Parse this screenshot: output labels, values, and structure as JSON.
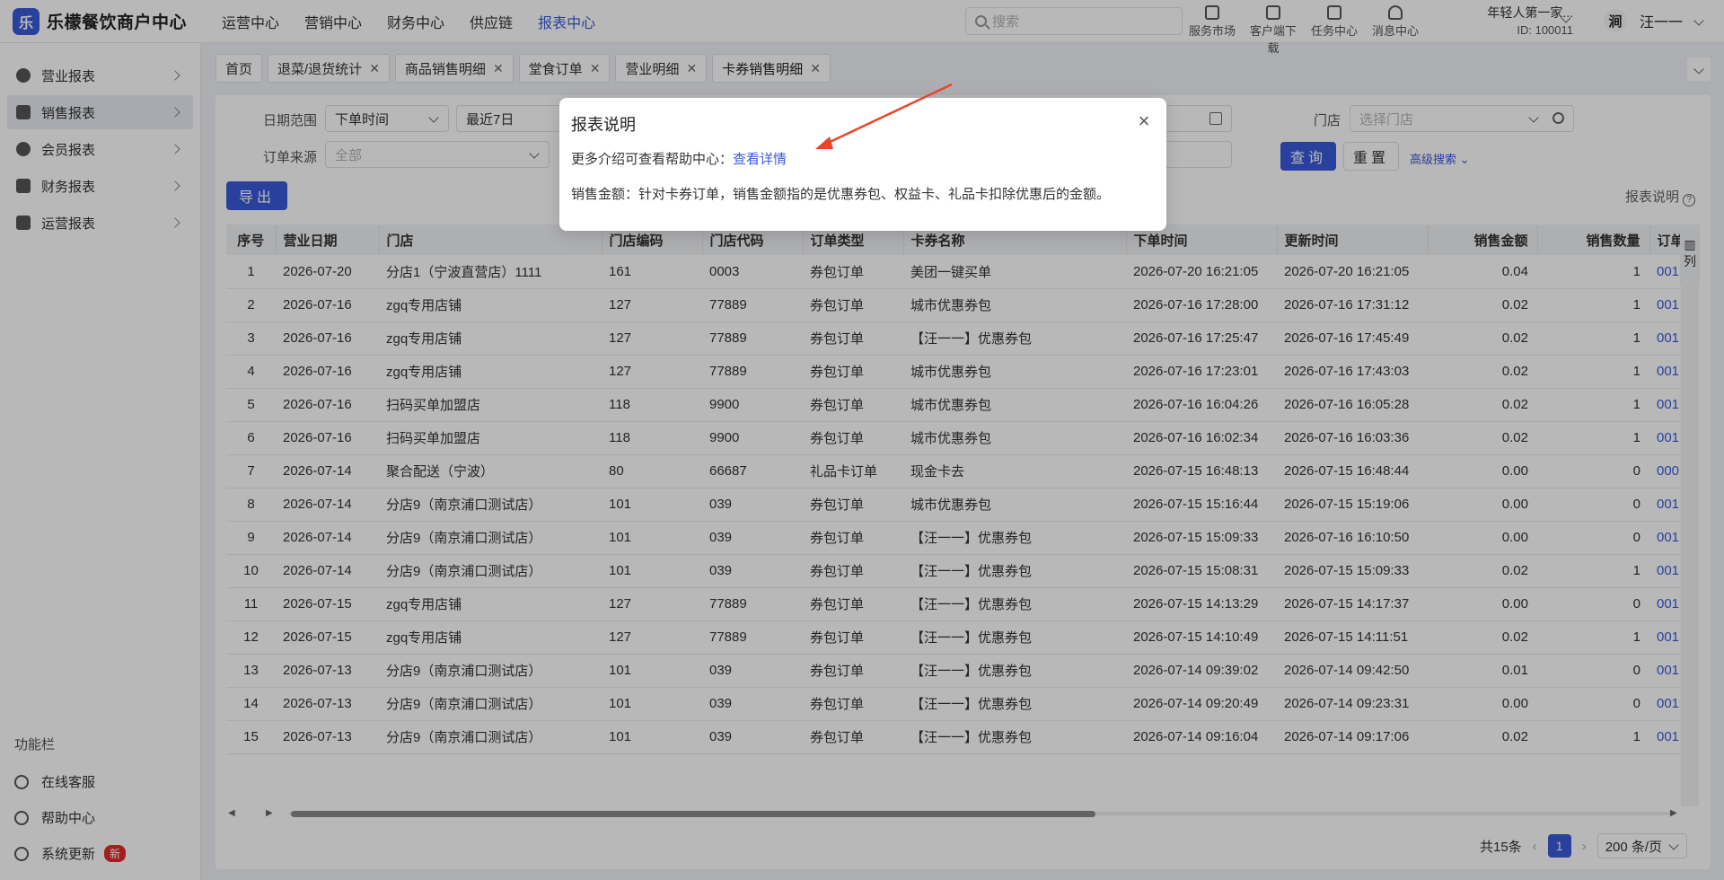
{
  "app": {
    "title": "乐檬餐饮商户中心",
    "logo_glyph": "乐"
  },
  "topnav": [
    {
      "label": "运营中心",
      "active": false
    },
    {
      "label": "营销中心",
      "active": false
    },
    {
      "label": "财务中心",
      "active": false
    },
    {
      "label": "供应链",
      "active": false
    },
    {
      "label": "报表中心",
      "active": true
    }
  ],
  "search": {
    "placeholder": "搜索"
  },
  "tools": [
    {
      "label": "服务市场",
      "icon": "market-icon"
    },
    {
      "label": "客户端下载",
      "icon": "download-icon"
    },
    {
      "label": "任务中心",
      "icon": "task-icon"
    },
    {
      "label": "消息中心",
      "icon": "bell-icon"
    }
  ],
  "tenant": {
    "name": "年轻人第一家...",
    "id": "ID: 100011"
  },
  "user": {
    "avatar_text": "涧",
    "name": "汪一一"
  },
  "sidebar": {
    "items": [
      {
        "label": "营业报表",
        "icon": "chart-pie-icon"
      },
      {
        "label": "销售报表",
        "icon": "bank-icon",
        "active": true
      },
      {
        "label": "会员报表",
        "icon": "user-icon"
      },
      {
        "label": "财务报表",
        "icon": "ledger-icon"
      },
      {
        "label": "运营报表",
        "icon": "briefcase-icon"
      }
    ],
    "func_title": "功能栏",
    "func_items": [
      {
        "label": "在线客服",
        "icon": "headset-icon"
      },
      {
        "label": "帮助中心",
        "icon": "help-icon"
      },
      {
        "label": "系统更新",
        "icon": "refresh-icon",
        "badge": "新"
      }
    ]
  },
  "tabs": [
    {
      "label": "首页",
      "closable": false
    },
    {
      "label": "退菜/退货统计",
      "closable": true
    },
    {
      "label": "商品销售明细",
      "closable": true
    },
    {
      "label": "堂食订单",
      "closable": true
    },
    {
      "label": "营业明细",
      "closable": true
    },
    {
      "label": "卡券销售明细",
      "closable": true,
      "active": true
    }
  ],
  "filters": {
    "date_range_label": "日期范围",
    "date_type": "下单时间",
    "date_preset": "最近7日",
    "store_label": "门店",
    "store_placeholder": "选择门店",
    "source_label": "订单来源",
    "source_value": "全部",
    "query_label": "查询",
    "reset_label": "重置",
    "advanced_label": "高级搜索"
  },
  "export_label": "导出",
  "report_note_label": "报表说明",
  "table": {
    "columns": [
      "序号",
      "营业日期",
      "门店",
      "门店编码",
      "门店代码",
      "订单类型",
      "卡券名称",
      "下单时间",
      "更新时间",
      "销售金额",
      "销售数量",
      "订单号"
    ],
    "rows": [
      [
        "1",
        "2026-07-20",
        "分店1（宁波直营店）1111",
        "161",
        "0003",
        "券包订单",
        "美团一键买单",
        "2026-07-20 16:21:05",
        "2026-07-20 16:21:05",
        "0.04",
        "1",
        "001"
      ],
      [
        "2",
        "2026-07-16",
        "zgq专用店铺",
        "127",
        "77889",
        "券包订单",
        "城市优惠券包",
        "2026-07-16 17:28:00",
        "2026-07-16 17:31:12",
        "0.02",
        "1",
        "001"
      ],
      [
        "3",
        "2026-07-16",
        "zgq专用店铺",
        "127",
        "77889",
        "券包订单",
        "【汪一一】优惠券包",
        "2026-07-16 17:25:47",
        "2026-07-16 17:45:49",
        "0.02",
        "1",
        "001"
      ],
      [
        "4",
        "2026-07-16",
        "zgq专用店铺",
        "127",
        "77889",
        "券包订单",
        "城市优惠券包",
        "2026-07-16 17:23:01",
        "2026-07-16 17:43:03",
        "0.02",
        "1",
        "001"
      ],
      [
        "5",
        "2026-07-16",
        "扫码买单加盟店",
        "118",
        "9900",
        "券包订单",
        "城市优惠券包",
        "2026-07-16 16:04:26",
        "2026-07-16 16:05:28",
        "0.02",
        "1",
        "001"
      ],
      [
        "6",
        "2026-07-16",
        "扫码买单加盟店",
        "118",
        "9900",
        "券包订单",
        "城市优惠券包",
        "2026-07-16 16:02:34",
        "2026-07-16 16:03:36",
        "0.02",
        "1",
        "001"
      ],
      [
        "7",
        "2026-07-14",
        "聚合配送（宁波）",
        "80",
        "66687",
        "礼品卡订单",
        "现金卡去",
        "2026-07-15 16:48:13",
        "2026-07-15 16:48:44",
        "0.00",
        "0",
        "000"
      ],
      [
        "8",
        "2026-07-14",
        "分店9（南京浦口测试店）",
        "101",
        "039",
        "券包订单",
        "城市优惠券包",
        "2026-07-15 15:16:44",
        "2026-07-15 15:19:06",
        "0.00",
        "0",
        "001"
      ],
      [
        "9",
        "2026-07-14",
        "分店9（南京浦口测试店）",
        "101",
        "039",
        "券包订单",
        "【汪一一】优惠券包",
        "2026-07-15 15:09:33",
        "2026-07-16 16:10:50",
        "0.00",
        "0",
        "001"
      ],
      [
        "10",
        "2026-07-14",
        "分店9（南京浦口测试店）",
        "101",
        "039",
        "券包订单",
        "【汪一一】优惠券包",
        "2026-07-15 15:08:31",
        "2026-07-15 15:09:33",
        "0.02",
        "1",
        "001"
      ],
      [
        "11",
        "2026-07-15",
        "zgq专用店铺",
        "127",
        "77889",
        "券包订单",
        "【汪一一】优惠券包",
        "2026-07-15 14:13:29",
        "2026-07-15 14:17:37",
        "0.00",
        "0",
        "001"
      ],
      [
        "12",
        "2026-07-15",
        "zgq专用店铺",
        "127",
        "77889",
        "券包订单",
        "【汪一一】优惠券包",
        "2026-07-15 14:10:49",
        "2026-07-15 14:11:51",
        "0.02",
        "1",
        "001"
      ],
      [
        "13",
        "2026-07-13",
        "分店9（南京浦口测试店）",
        "101",
        "039",
        "券包订单",
        "【汪一一】优惠券包",
        "2026-07-14 09:39:02",
        "2026-07-14 09:42:50",
        "0.01",
        "0",
        "001"
      ],
      [
        "14",
        "2026-07-13",
        "分店9（南京浦口测试店）",
        "101",
        "039",
        "券包订单",
        "【汪一一】优惠券包",
        "2026-07-14 09:20:49",
        "2026-07-14 09:23:31",
        "0.00",
        "0",
        "001"
      ],
      [
        "15",
        "2026-07-13",
        "分店9（南京浦口测试店）",
        "101",
        "039",
        "券包订单",
        "【汪一一】优惠券包",
        "2026-07-14 09:16:04",
        "2026-07-14 09:17:06",
        "0.02",
        "1",
        "001"
      ]
    ],
    "col_settings_label": "列"
  },
  "pager": {
    "total": "共15条",
    "current_page": "1",
    "page_size": "200 条/页"
  },
  "modal": {
    "title": "报表说明",
    "line1_prefix": "更多介绍可查看帮助中心：",
    "line1_link": "查看详情",
    "line2": "销售金额：针对卡券订单，销售金额指的是优惠券包、权益卡、礼品卡扣除优惠后的金额。",
    "close_glyph": "×"
  },
  "colors": {
    "accent": "#3a5bd9",
    "annotation_arrow": "#e8452c",
    "badge": "#e02b2b"
  }
}
